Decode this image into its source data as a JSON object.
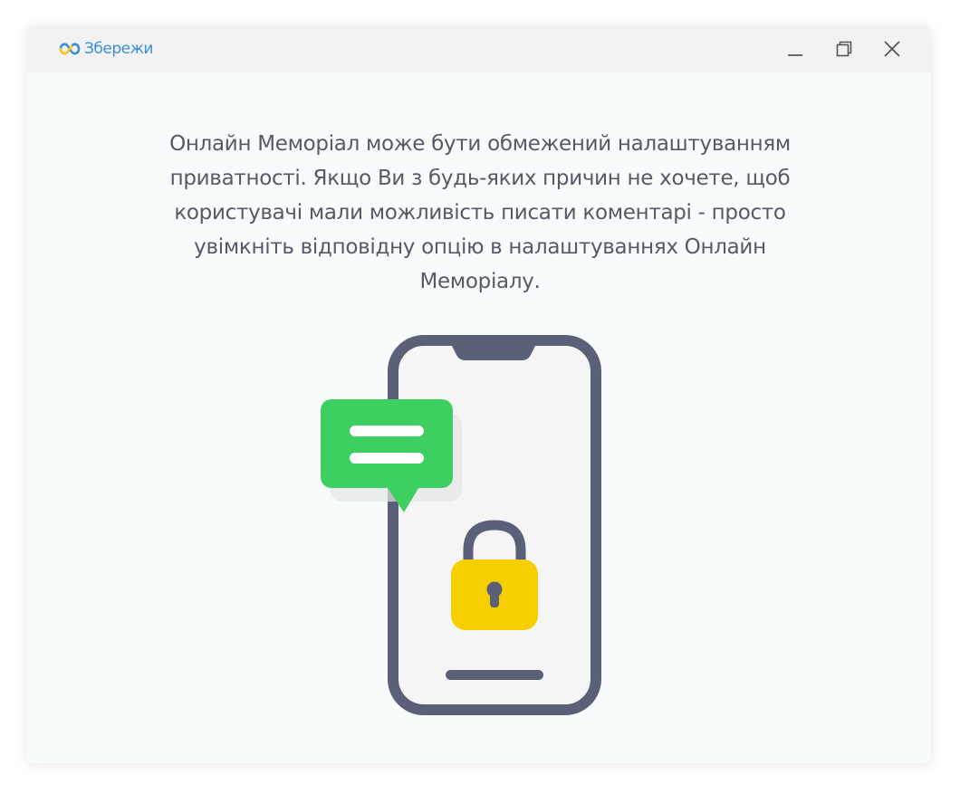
{
  "app": {
    "logo_text": "Збережи",
    "logo_icon": "infinity-heart-icon"
  },
  "window_controls": {
    "minimize_icon": "minimize-icon",
    "maximize_icon": "restore-icon",
    "close_icon": "close-icon"
  },
  "main": {
    "message": "Онлайн Меморіал може бути обмежений налаштуванням приватності. Якщо Ви з будь-яких причин не хочете, щоб користувачі мали можливість писати коментарі - просто увімкніть відповідну опцію в налаштуваннях Онлайн Меморіалу."
  },
  "illustration": {
    "phone_icon": "smartphone-icon",
    "chat_icon": "chat-bubble-icon",
    "lock_icon": "padlock-icon"
  },
  "colors": {
    "logo_blue": "#3a8fd8",
    "logo_yellow": "#f5c518",
    "phone_frame": "#5a6078",
    "chat_green": "#3dcf5f",
    "lock_yellow": "#f7cf00"
  }
}
